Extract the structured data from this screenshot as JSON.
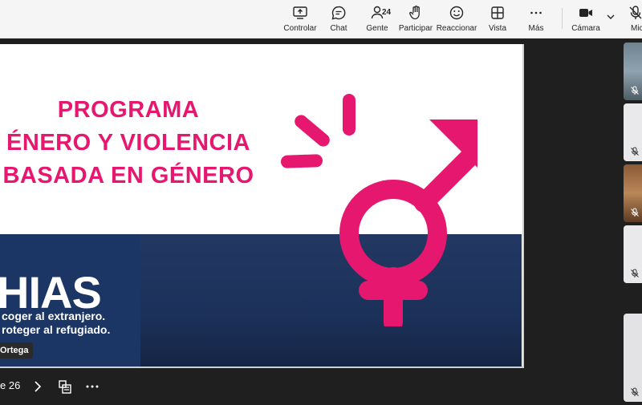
{
  "toolbar": {
    "items": [
      {
        "label": "Controlar",
        "icon": "share-screen-icon"
      },
      {
        "label": "Chat",
        "icon": "chat-icon"
      },
      {
        "label": "Gente",
        "icon": "people-icon",
        "count": "24"
      },
      {
        "label": "Participar",
        "icon": "raise-hand-icon"
      },
      {
        "label": "Reaccionar",
        "icon": "smiley-icon"
      },
      {
        "label": "Vista",
        "icon": "grid-view-icon"
      },
      {
        "label": "Más",
        "icon": "more-icon"
      },
      {
        "label": "Cámara",
        "icon": "camera-icon"
      },
      {
        "label": "Micr",
        "icon": "microphone-icon"
      }
    ]
  },
  "slide": {
    "title_lines": [
      "PROGRAMA",
      "ÉNERO Y VIOLENCIA",
      "BASADA EN GÉNERO"
    ],
    "brand": "HIAS",
    "tagline_1": "coger al extranjero.",
    "tagline_2": "roteger al refugiado.",
    "presenter_tag": "Ortega"
  },
  "colors": {
    "accent_pink": "#e6176f",
    "hias_blue": "#1c315a",
    "toolbar_bg": "#f5f5f5"
  },
  "slide_nav": {
    "page_text": "e 26"
  },
  "participants": {
    "tile_count": 6
  }
}
